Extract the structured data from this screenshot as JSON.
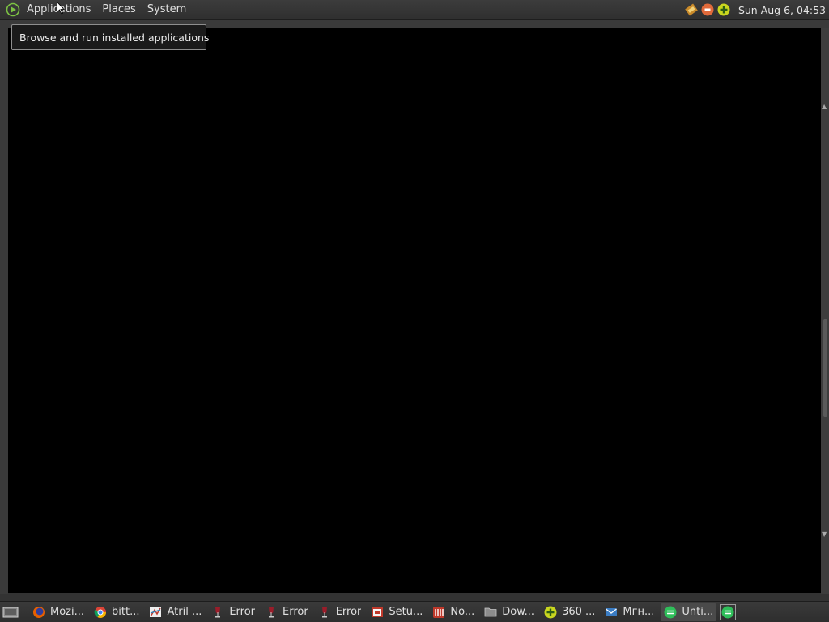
{
  "top_panel": {
    "menus": [
      "Applications",
      "Places",
      "System"
    ],
    "clock": "Sun Aug  6, 04:53",
    "tray_icons": [
      "pencil-icon",
      "stop-icon",
      "plus-circle-icon"
    ]
  },
  "tooltip": {
    "text": "Browse and run installed applications"
  },
  "taskbar": {
    "items": [
      {
        "label": "Mozi...",
        "icon": "firefox-icon"
      },
      {
        "label": "bitt...",
        "icon": "chrome-icon"
      },
      {
        "label": "Atril ...",
        "icon": "atril-icon"
      },
      {
        "label": "Error",
        "icon": "wine-icon"
      },
      {
        "label": "Error",
        "icon": "wine-icon"
      },
      {
        "label": "Error",
        "icon": "wine-icon"
      },
      {
        "label": "Setu...",
        "icon": "setup-icon"
      },
      {
        "label": "No...",
        "icon": "notes-icon"
      },
      {
        "label": "Dow...",
        "icon": "folder-icon"
      },
      {
        "label": "360 ...",
        "icon": "360-icon"
      },
      {
        "label": "Мгн...",
        "icon": "messenger-icon"
      },
      {
        "label": "Unti...",
        "icon": "app-green-icon"
      }
    ]
  },
  "colors": {
    "panel": "#333333",
    "window_bg": "#000000",
    "accent_green": "#7cc243"
  }
}
